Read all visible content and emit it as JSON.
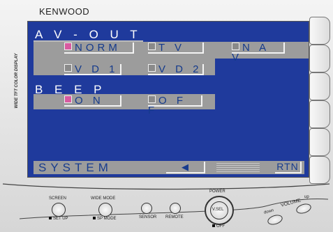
{
  "brand": "KENWOOD",
  "model": "",
  "side_text": "WIDE TFT COLOR DISPLAY",
  "screen": {
    "av_out": {
      "label": "A V - O U T",
      "options": [
        {
          "label": "NORM",
          "selected": true
        },
        {
          "label": "T V",
          "selected": false
        },
        {
          "label": "N A V",
          "selected": false
        },
        {
          "label": "V D 1",
          "selected": false
        },
        {
          "label": "V D 2",
          "selected": false
        }
      ]
    },
    "beep": {
      "label": "B E E P",
      "options": [
        {
          "label": "O N",
          "selected": true
        },
        {
          "label": "O F F",
          "selected": false
        }
      ]
    },
    "footer": {
      "system_label": "SYSTEM",
      "prev_arrow": "◀",
      "return_label": "RTN"
    }
  },
  "controls": {
    "screen": "SCREEN",
    "setup": "SET UP",
    "wide_mode": "WIDE MODE",
    "sp_mode": "SP MODE",
    "sensor": "SENSOR",
    "remote": "REMOTE",
    "power": "POWER",
    "vsel": "V.SEL",
    "off": "OFF",
    "down": "down",
    "volume": "VOLUME",
    "up": "up"
  },
  "colors": {
    "screen_bg": "#1f3a9c",
    "band": "#9c9c9c",
    "selected_marker": "#d85aa0",
    "text_blue": "#173c8e"
  }
}
